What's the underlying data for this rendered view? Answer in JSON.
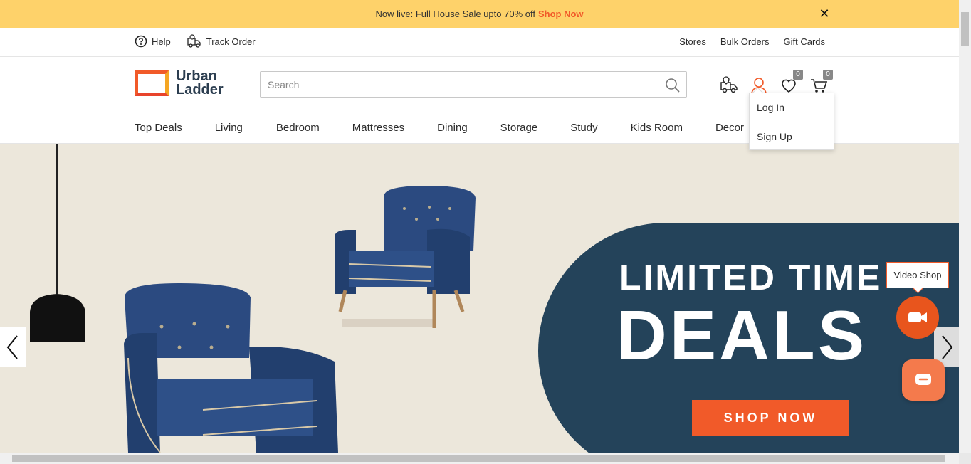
{
  "promo": {
    "text": "Now live: Full House Sale upto 70% off",
    "link": "Shop Now",
    "close": "✕"
  },
  "util": {
    "help": "Help",
    "track": "Track Order",
    "stores": "Stores",
    "bulk": "Bulk Orders",
    "gift": "Gift Cards"
  },
  "logo": {
    "line1": "Urban",
    "line2": "Ladder"
  },
  "search": {
    "placeholder": "Search"
  },
  "header_icons": {
    "wishlist_count": "0",
    "cart_count": "0"
  },
  "account_menu": {
    "login": "Log In",
    "signup": "Sign Up"
  },
  "nav": {
    "items": [
      "Top Deals",
      "Living",
      "Bedroom",
      "Mattresses",
      "Dining",
      "Storage",
      "Study",
      "Kids Room",
      "Decor"
    ]
  },
  "hero": {
    "line1": "LIMITED TIME",
    "line2": "DEALS",
    "cta": "SHOP NOW"
  },
  "floating": {
    "video_tip": "Video Shop"
  },
  "colors": {
    "accent": "#f15a29",
    "promo_bg": "#fed26a",
    "panel": "#24435a",
    "chair": "#2b4a80"
  }
}
